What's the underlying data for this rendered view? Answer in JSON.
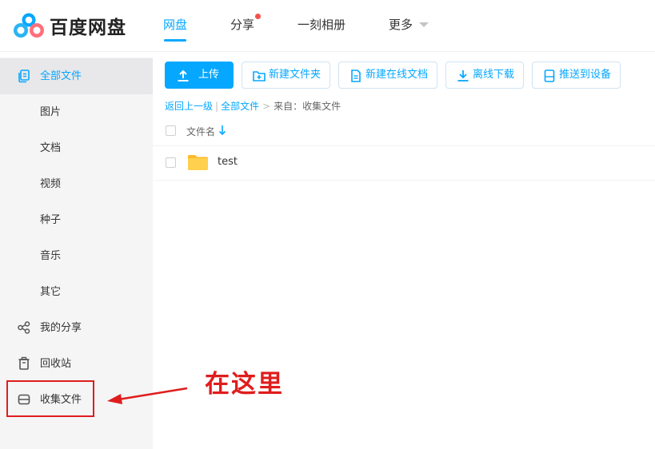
{
  "app": {
    "title": "百度网盘"
  },
  "nav": {
    "items": [
      "网盘",
      "分享",
      "一刻相册",
      "更多"
    ],
    "active": "网盘"
  },
  "sidebar": {
    "items": [
      "全部文件",
      "图片",
      "文档",
      "视频",
      "种子",
      "音乐",
      "其它",
      "我的分享",
      "回收站",
      "收集文件"
    ],
    "active": "全部文件"
  },
  "toolbar": {
    "upload": "上传",
    "new_folder": "新建文件夹",
    "new_doc": "新建在线文档",
    "offline": "离线下载",
    "push": "推送到设备"
  },
  "breadcrumb": {
    "back": "返回上一级",
    "divider": "|",
    "all": "全部文件",
    "arrow": ">",
    "source": "来自：收集文件"
  },
  "file_list": {
    "column_name": "文件名",
    "rows": [
      {
        "name": "test",
        "type": "folder"
      }
    ]
  },
  "annotation": {
    "text": "在这里",
    "color": "#e01d1d"
  },
  "colors": {
    "accent": "#06a7ff",
    "sidebar_bg": "#f5f5f6",
    "notify_dot": "#f4524b",
    "folder": "#ffc93d"
  },
  "icons": [
    "baidu-cloud-logo-icon",
    "copy-files-icon",
    "share-nodes-icon",
    "trash-icon",
    "inbox-icon",
    "upload-icon",
    "folder-plus-icon",
    "document-icon",
    "download-icon",
    "device-icon",
    "sort-down-icon",
    "folder-icon",
    "arrow-left-icon"
  ]
}
